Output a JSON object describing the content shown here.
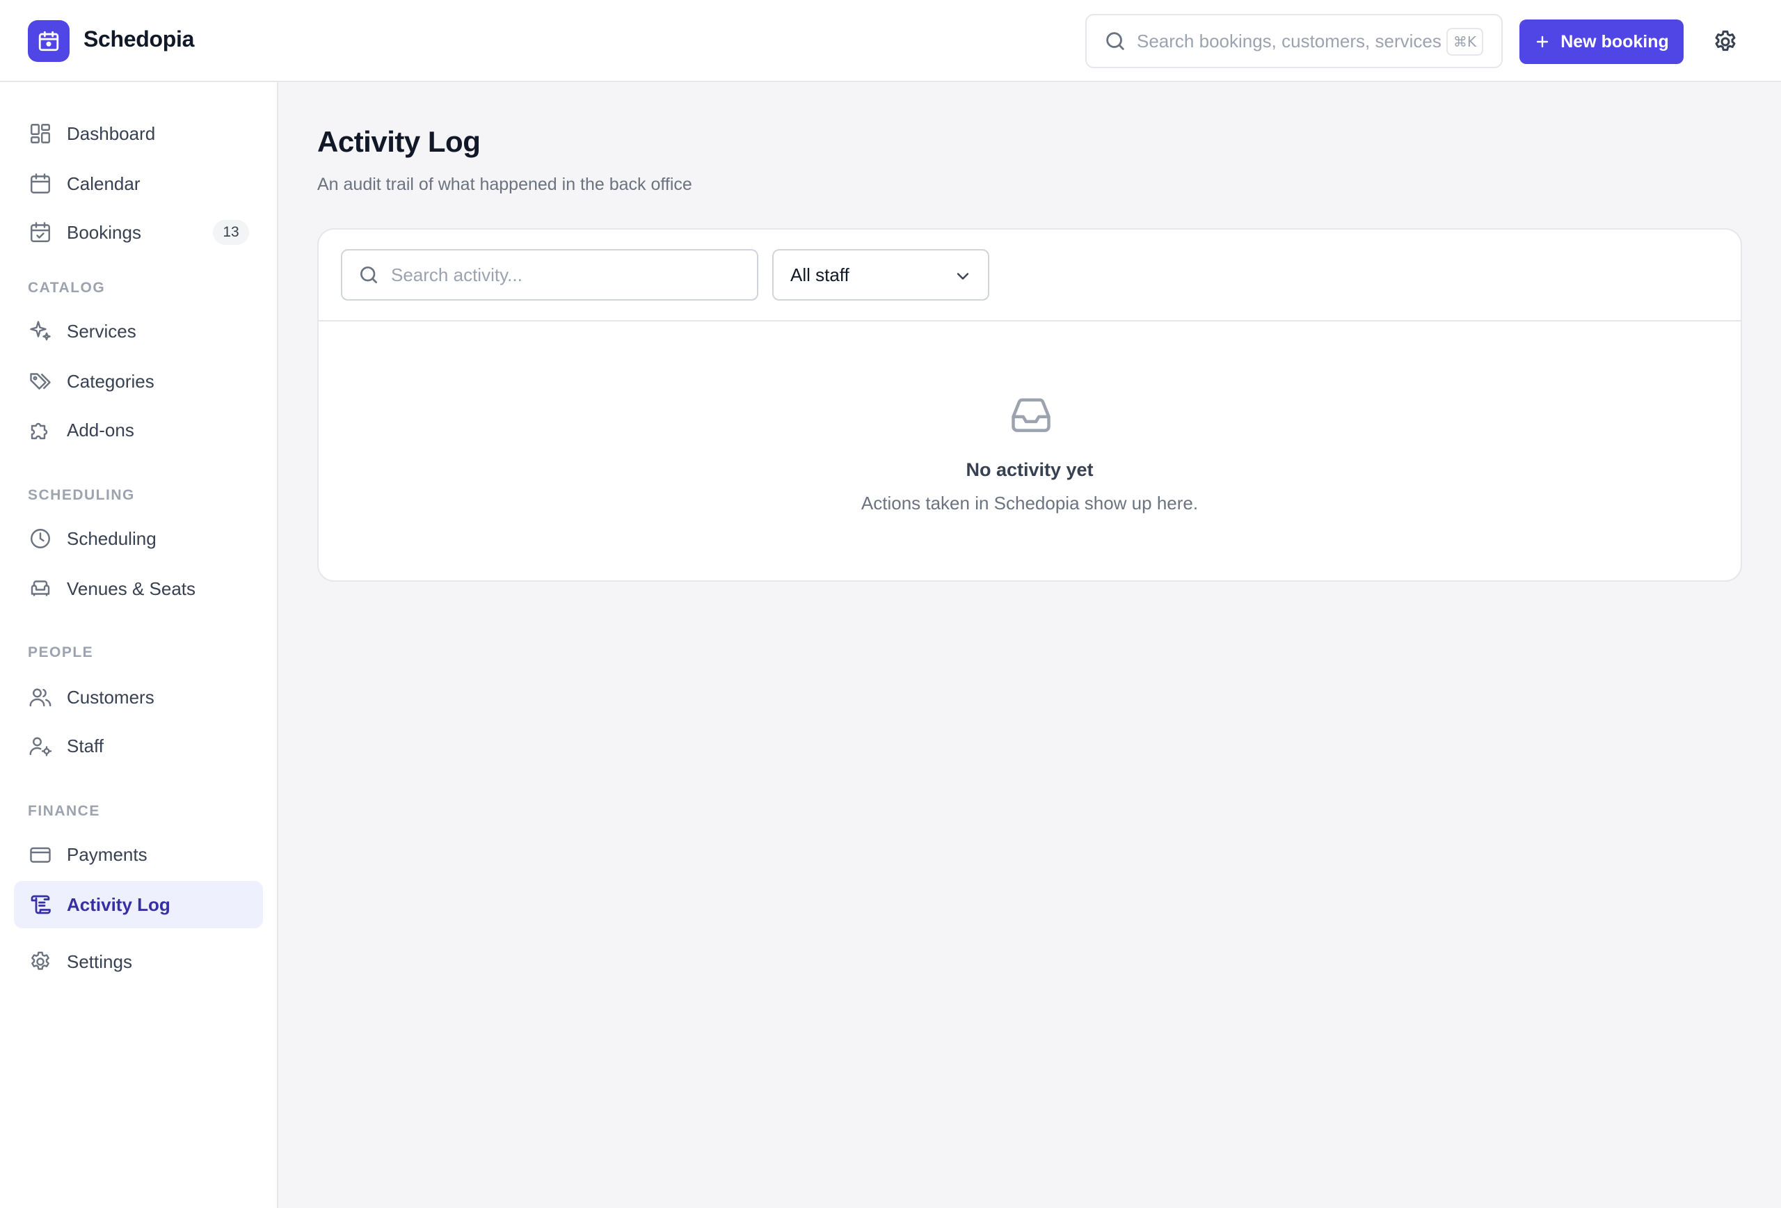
{
  "app": {
    "name": "Schedopia",
    "logo_icon": "calendar-icon",
    "accent_color": "#4f46e5"
  },
  "header": {
    "search_placeholder": "Search bookings, customers, services",
    "search_shortcut": "⌘K",
    "new_booking_label": "New booking",
    "settings_icon": "gear-icon"
  },
  "sidebar": {
    "items": [
      {
        "label": "Dashboard",
        "icon": "dashboard-grid-icon"
      },
      {
        "label": "Calendar",
        "icon": "calendar-icon"
      },
      {
        "label": "Bookings",
        "icon": "calendar-check-icon",
        "badge": "13"
      }
    ],
    "sections": [
      {
        "label": "CATALOG",
        "items": [
          {
            "label": "Services",
            "icon": "sparkles-icon"
          },
          {
            "label": "Categories",
            "icon": "tags-icon"
          },
          {
            "label": "Add-ons",
            "icon": "puzzle-icon"
          }
        ]
      },
      {
        "label": "SCHEDULING",
        "items": [
          {
            "label": "Scheduling",
            "icon": "clock-icon"
          },
          {
            "label": "Venues & Seats",
            "icon": "armchair-icon"
          }
        ]
      },
      {
        "label": "PEOPLE",
        "items": [
          {
            "label": "Customers",
            "icon": "users-icon"
          },
          {
            "label": "Staff",
            "icon": "user-cog-icon"
          }
        ]
      },
      {
        "label": "FINANCE",
        "items": [
          {
            "label": "Payments",
            "icon": "credit-card-icon"
          },
          {
            "label": "Activity Log",
            "icon": "scroll-icon",
            "active": true
          }
        ]
      }
    ],
    "footer_item": {
      "label": "Settings",
      "icon": "gear-icon"
    }
  },
  "main": {
    "title": "Activity Log",
    "subtitle": "An audit trail of what happened in the back office",
    "filters": {
      "search_placeholder": "Search activity...",
      "staff_select_value": "All staff"
    },
    "empty_state": {
      "icon": "inbox-icon",
      "title": "No activity yet",
      "text": "Actions taken in Schedopia show up here."
    }
  }
}
